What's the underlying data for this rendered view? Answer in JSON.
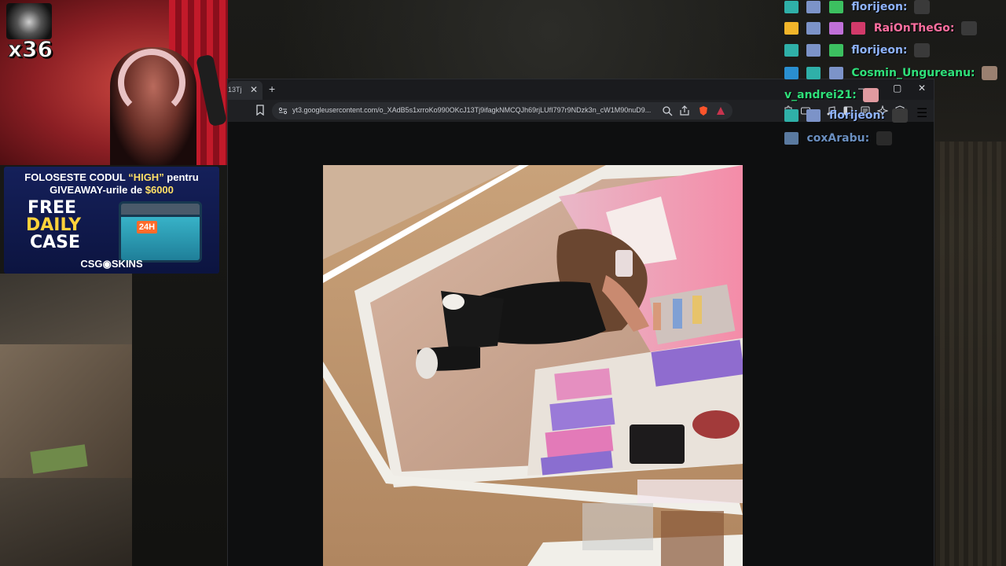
{
  "stream": {
    "multiplier": "x36"
  },
  "ad": {
    "line1_pre": "FOLOSESTE CODUL ",
    "line1_code": "“HIGH”",
    "line1_post": " pentru",
    "line2_pre": "GIVEAWAY-urile de ",
    "line2_amount": "$6000",
    "free": "FREE",
    "daily": "DAILY",
    "case": "CASE",
    "crate_badge": "24H",
    "brand": "CSG◉SKINS"
  },
  "browser": {
    "tab_title": "13Tj",
    "tab_close": "✕",
    "new_tab": "+",
    "minimize": "—",
    "maximize": "▢",
    "close": "✕",
    "url": "yt3.googleusercontent.com/o_XAdB5s1xrroKo990OKcJ13Tj9ifagkNMCQJh69rjLUfI797r9NDzk3n_cW1M90nuD9...",
    "menu": "☰"
  },
  "colors": {
    "browser_bg": "#0e0f10",
    "url_bg": "#2a2c30",
    "chat_green": "#2fe07a",
    "chat_blue": "#8fb4ff",
    "chat_pink": "#ff6fa0"
  },
  "chat": {
    "messages": [
      {
        "user": "florijeon:",
        "color": "#8fb4ff"
      },
      {
        "user": "RaiOnTheGo:",
        "color": "#ff6fa0"
      },
      {
        "user": "florijeon:",
        "color": "#8fb4ff"
      },
      {
        "user": "Cosmin_Ungureanu:",
        "color": "#2fe07a"
      },
      {
        "user": "v_andrei21:",
        "color": "#2fe07a"
      },
      {
        "user": "florijeon:",
        "color": "#8fb4ff"
      },
      {
        "user": "coxArabu:",
        "color": "#6a8fc0"
      }
    ]
  }
}
